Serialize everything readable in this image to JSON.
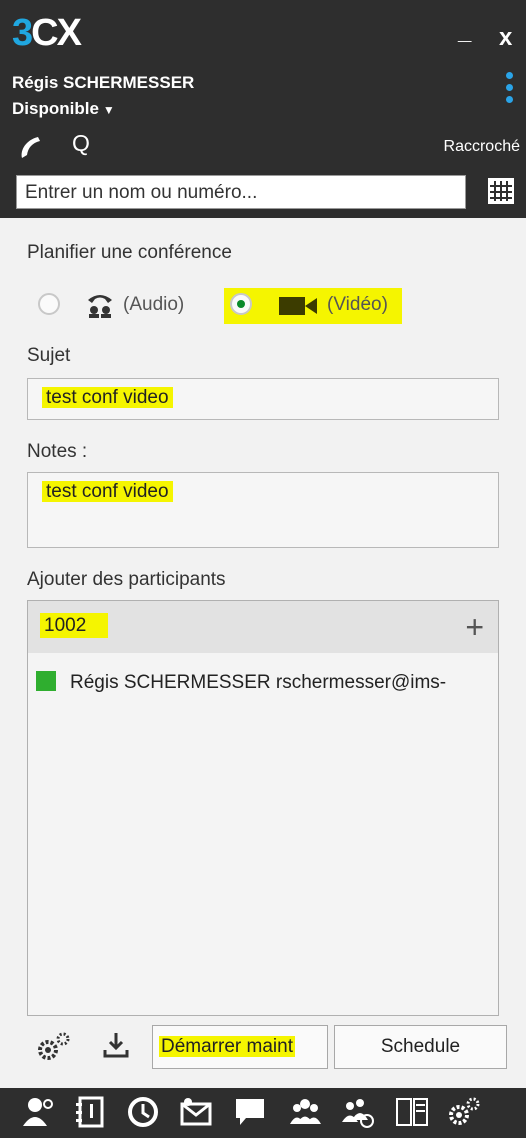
{
  "header": {
    "logo_three": "3",
    "logo_cx": "CX",
    "minimize": "_",
    "close": "x",
    "username": "Régis SCHERMESSER",
    "status": "Disponible",
    "hangup_label": "Raccroché",
    "search_placeholder": "Entrer un nom ou numéro..."
  },
  "form": {
    "title": "Planifier une conférence",
    "audio_label": "(Audio)",
    "video_label": "(Vidéo)",
    "selected_mode": "video",
    "subject_label": "Sujet",
    "subject_value": "test conf video",
    "notes_label": "Notes :",
    "notes_value": "test conf video",
    "participants_label": "Ajouter des participants",
    "participant_input": "1002",
    "participants": [
      {
        "name": "Régis SCHERMESSER rschermesser@ims-",
        "status_color": "#2fae2f"
      }
    ]
  },
  "actions": {
    "start_label": "Démarrer maint",
    "schedule_label": "Schedule"
  },
  "colors": {
    "accent_blue": "#20a7e0",
    "dark_bg": "#2e2e2e",
    "highlight": "#f5f500",
    "online_green": "#2fae2f"
  },
  "footer_icons": [
    "contacts-icon",
    "phonebook-icon",
    "history-icon",
    "voicemail-icon",
    "chat-icon",
    "group-icon",
    "conference-icon",
    "switchboard-icon",
    "settings-icon"
  ]
}
